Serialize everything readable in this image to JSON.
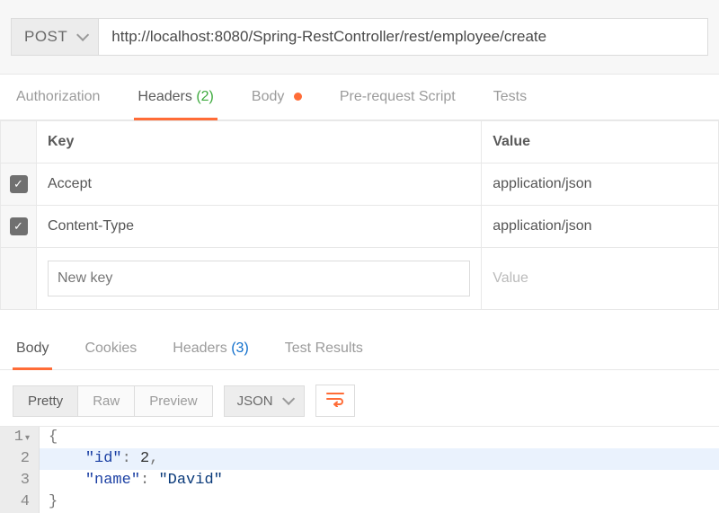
{
  "request": {
    "method": "POST",
    "url": "http://localhost:8080/Spring-RestController/rest/employee/create"
  },
  "tabs": {
    "authorization": "Authorization",
    "headers_label": "Headers",
    "headers_count": "(2)",
    "body": "Body",
    "prerequest": "Pre-request Script",
    "tests": "Tests"
  },
  "headers_table": {
    "col_key": "Key",
    "col_value": "Value",
    "rows": [
      {
        "key": "Accept",
        "value": "application/json"
      },
      {
        "key": "Content-Type",
        "value": "application/json"
      }
    ],
    "new_key_placeholder": "New key",
    "new_value_placeholder": "Value"
  },
  "response_tabs": {
    "body": "Body",
    "cookies": "Cookies",
    "headers_label": "Headers",
    "headers_count": "(3)",
    "test_results": "Test Results"
  },
  "body_toolbar": {
    "pretty": "Pretty",
    "raw": "Raw",
    "preview": "Preview",
    "format": "JSON"
  },
  "code": {
    "line1": "{",
    "key_id": "\"id\"",
    "val_id": "2",
    "key_name": "\"name\"",
    "val_name": "\"David\"",
    "line4": "}"
  }
}
